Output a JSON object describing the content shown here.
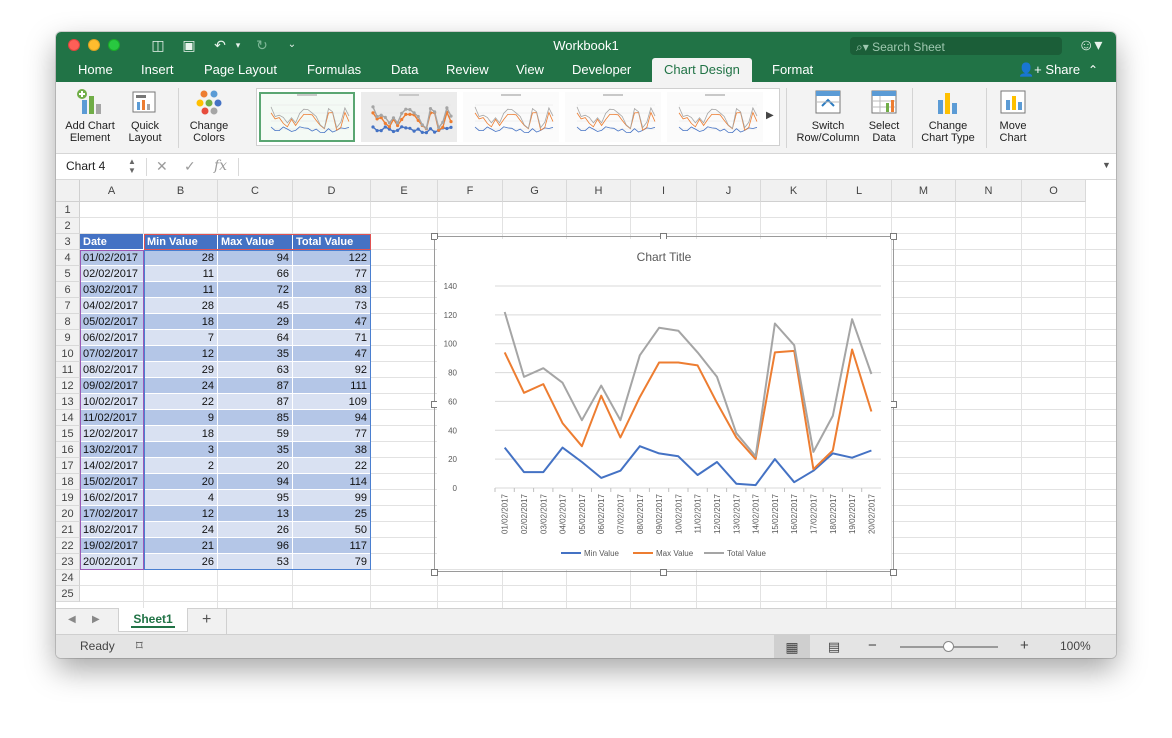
{
  "window": {
    "title": "Workbook1"
  },
  "search": {
    "placeholder": "Search Sheet"
  },
  "tabs": [
    {
      "label": "Home"
    },
    {
      "label": "Insert"
    },
    {
      "label": "Page Layout"
    },
    {
      "label": "Formulas"
    },
    {
      "label": "Data"
    },
    {
      "label": "Review"
    },
    {
      "label": "View"
    },
    {
      "label": "Developer"
    },
    {
      "label": "Chart Design"
    },
    {
      "label": "Format"
    }
  ],
  "share_label": "Share",
  "ribbon": {
    "add_chart_element": [
      "Add Chart",
      "Element"
    ],
    "quick_layout": [
      "Quick",
      "Layout"
    ],
    "change_colors": [
      "Change",
      "Colors"
    ],
    "switch_row_column": [
      "Switch",
      "Row/Column"
    ],
    "select_data": [
      "Select",
      "Data"
    ],
    "change_chart_type": [
      "Change",
      "Chart Type"
    ],
    "move_chart": [
      "Move",
      "Chart"
    ]
  },
  "formula_bar": {
    "name_box": "Chart 4",
    "fx": "fx"
  },
  "columns": [
    "A",
    "B",
    "C",
    "D",
    "E",
    "F",
    "G",
    "H",
    "I",
    "J",
    "K",
    "L",
    "M",
    "N",
    "O"
  ],
  "rows": [
    "1",
    "2",
    "3",
    "4",
    "5",
    "6",
    "7",
    "8",
    "9",
    "10",
    "11",
    "12",
    "13",
    "14",
    "15",
    "16",
    "17",
    "18",
    "19",
    "20",
    "21",
    "22",
    "23",
    "24",
    "25"
  ],
  "table": {
    "headers": [
      "Date",
      "Min Value",
      "Max Value",
      "Total Value"
    ],
    "rows": [
      [
        "01/02/2017",
        "28",
        "94",
        "122"
      ],
      [
        "02/02/2017",
        "11",
        "66",
        "77"
      ],
      [
        "03/02/2017",
        "11",
        "72",
        "83"
      ],
      [
        "04/02/2017",
        "28",
        "45",
        "73"
      ],
      [
        "05/02/2017",
        "18",
        "29",
        "47"
      ],
      [
        "06/02/2017",
        "7",
        "64",
        "71"
      ],
      [
        "07/02/2017",
        "12",
        "35",
        "47"
      ],
      [
        "08/02/2017",
        "29",
        "63",
        "92"
      ],
      [
        "09/02/2017",
        "24",
        "87",
        "111"
      ],
      [
        "10/02/2017",
        "22",
        "87",
        "109"
      ],
      [
        "11/02/2017",
        "9",
        "85",
        "94"
      ],
      [
        "12/02/2017",
        "18",
        "59",
        "77"
      ],
      [
        "13/02/2017",
        "3",
        "35",
        "38"
      ],
      [
        "14/02/2017",
        "2",
        "20",
        "22"
      ],
      [
        "15/02/2017",
        "20",
        "94",
        "114"
      ],
      [
        "16/02/2017",
        "4",
        "95",
        "99"
      ],
      [
        "17/02/2017",
        "12",
        "13",
        "25"
      ],
      [
        "18/02/2017",
        "24",
        "26",
        "50"
      ],
      [
        "19/02/2017",
        "21",
        "96",
        "117"
      ],
      [
        "20/02/2017",
        "26",
        "53",
        "79"
      ]
    ]
  },
  "chart_data": {
    "type": "line",
    "title": "Chart Title",
    "categories": [
      "01/02/2017",
      "02/02/2017",
      "03/02/2017",
      "04/02/2017",
      "05/02/2017",
      "06/02/2017",
      "07/02/2017",
      "08/02/2017",
      "09/02/2017",
      "10/02/2017",
      "11/02/2017",
      "12/02/2017",
      "13/02/2017",
      "14/02/2017",
      "15/02/2017",
      "16/02/2017",
      "17/02/2017",
      "18/02/2017",
      "19/02/2017",
      "20/02/2017"
    ],
    "series": [
      {
        "name": "Min Value",
        "color": "#4472c4",
        "values": [
          28,
          11,
          11,
          28,
          18,
          7,
          12,
          29,
          24,
          22,
          9,
          18,
          3,
          2,
          20,
          4,
          12,
          24,
          21,
          26
        ]
      },
      {
        "name": "Max Value",
        "color": "#ed7d31",
        "values": [
          94,
          66,
          72,
          45,
          29,
          64,
          35,
          63,
          87,
          87,
          85,
          59,
          35,
          20,
          94,
          95,
          13,
          26,
          96,
          53
        ]
      },
      {
        "name": "Total Value",
        "color": "#a5a5a5",
        "values": [
          122,
          77,
          83,
          73,
          47,
          71,
          47,
          92,
          111,
          109,
          94,
          77,
          38,
          22,
          114,
          99,
          25,
          50,
          117,
          79
        ]
      }
    ],
    "ylim": [
      0,
      140
    ],
    "yticks": [
      "0",
      "20",
      "40",
      "60",
      "80",
      "100",
      "120",
      "140"
    ],
    "grid": true,
    "legend": "bottom"
  },
  "sheet_tab": "Sheet1",
  "status": {
    "ready": "Ready",
    "zoom": "100%"
  }
}
